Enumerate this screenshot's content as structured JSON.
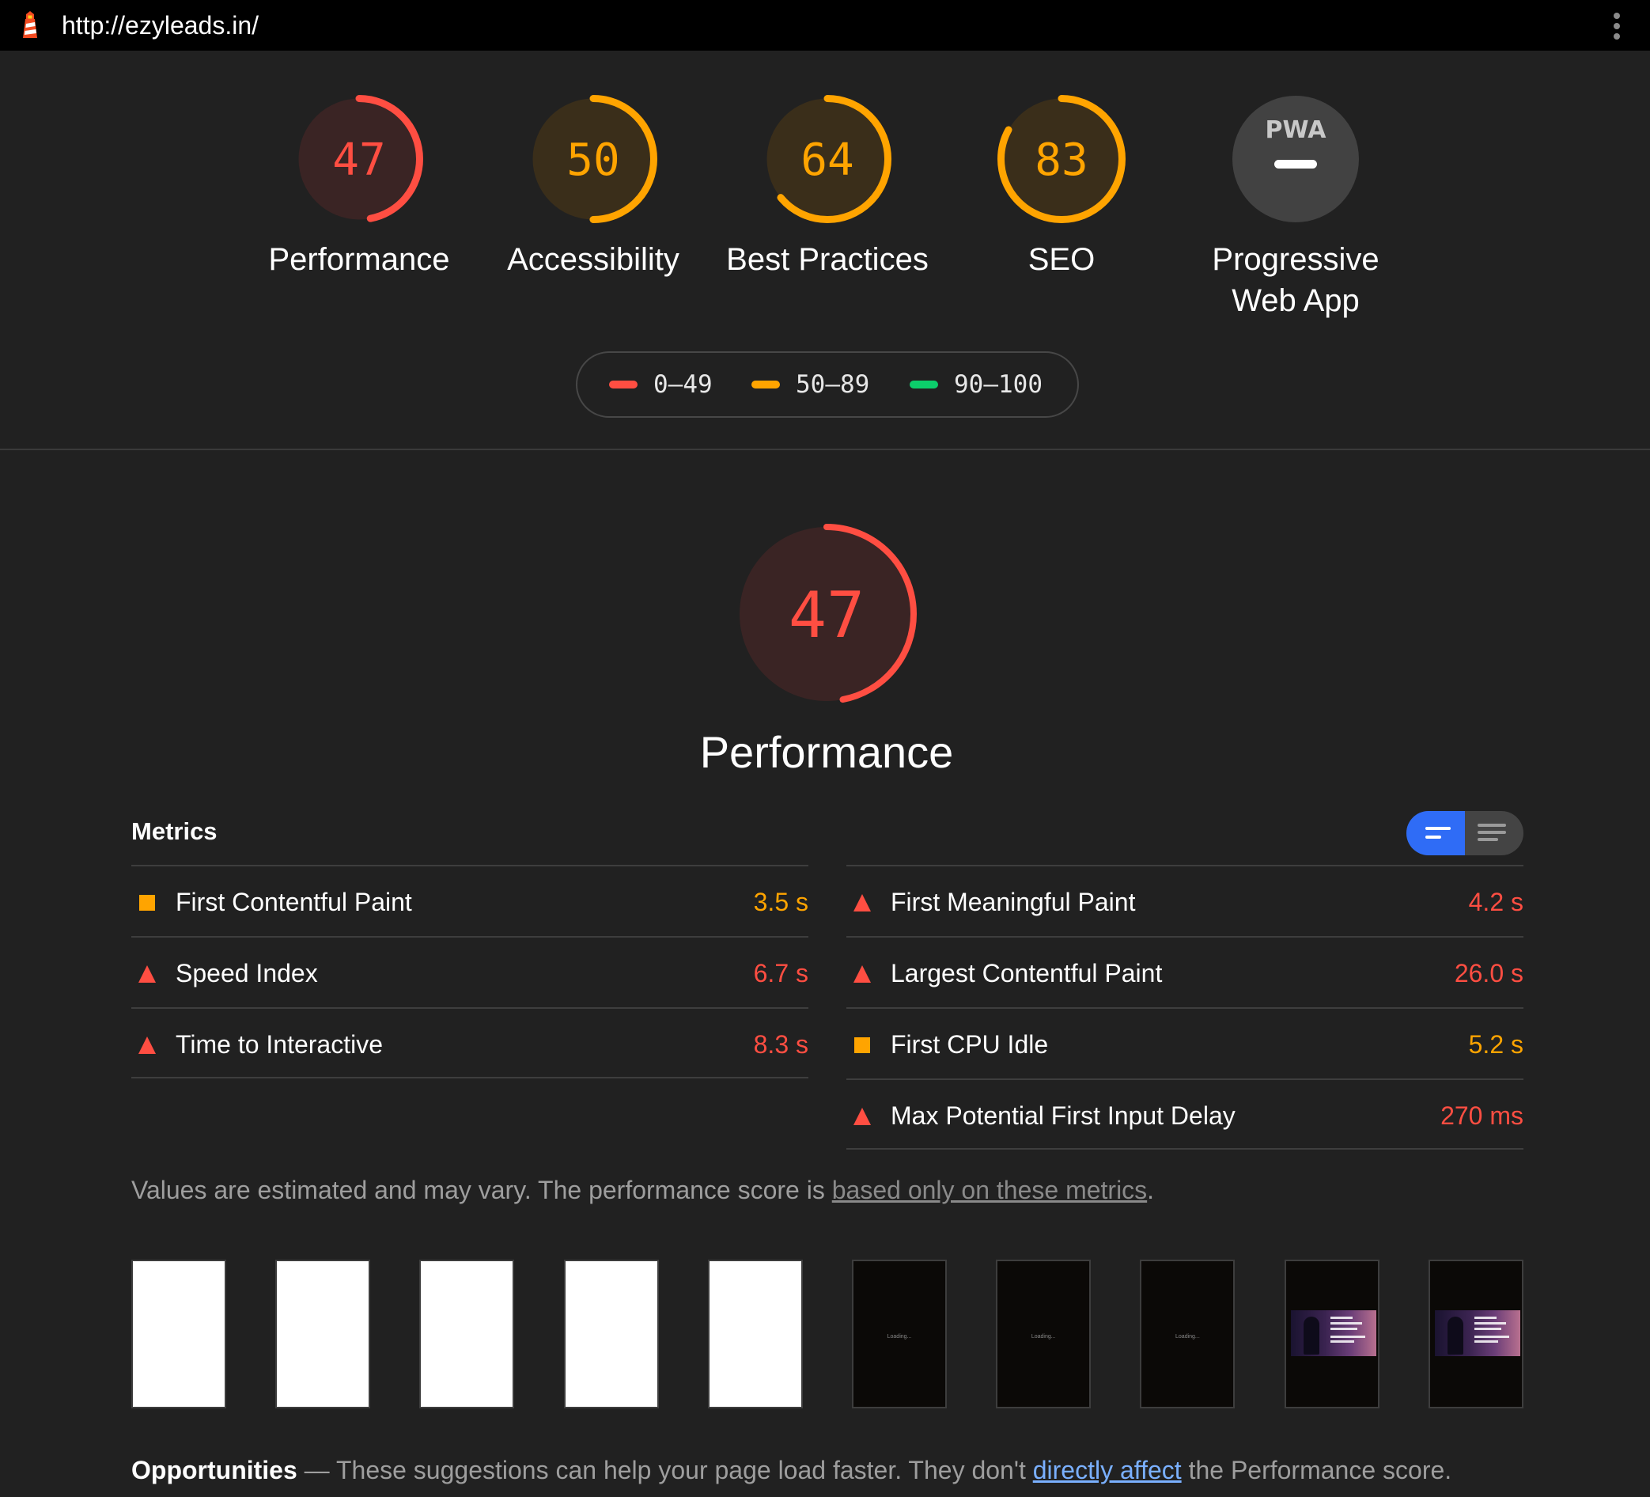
{
  "browser": {
    "url": "http://ezyleads.in/",
    "icon": "lighthouse-icon",
    "menu_icon": "more-vert-icon"
  },
  "colors": {
    "fail": "#ff4e42",
    "average": "#ffa400",
    "pass": "#0cce6b",
    "accent": "#2f6cf6",
    "link": "#7ab0ff"
  },
  "categories": [
    {
      "label": "Performance",
      "score": 47
    },
    {
      "label": "Accessibility",
      "score": 50
    },
    {
      "label": "Best Practices",
      "score": 64
    },
    {
      "label": "SEO",
      "score": 83
    },
    {
      "label": "Progressive Web App",
      "score": null,
      "badge": "PWA"
    }
  ],
  "legend": [
    {
      "range": "0–49"
    },
    {
      "range": "50–89"
    },
    {
      "range": "90–100"
    }
  ],
  "performance": {
    "score": 47,
    "title": "Performance"
  },
  "metrics": {
    "heading": "Metrics",
    "left": [
      {
        "name": "First Contentful Paint",
        "value": "3.5 s",
        "status": "average"
      },
      {
        "name": "Speed Index",
        "value": "6.7 s",
        "status": "fail"
      },
      {
        "name": "Time to Interactive",
        "value": "8.3 s",
        "status": "fail"
      }
    ],
    "right": [
      {
        "name": "First Meaningful Paint",
        "value": "4.2 s",
        "status": "fail"
      },
      {
        "name": "Largest Contentful Paint",
        "value": "26.0 s",
        "status": "fail"
      },
      {
        "name": "First CPU Idle",
        "value": "5.2 s",
        "status": "average"
      },
      {
        "name": "Max Potential First Input Delay",
        "value": "270 ms",
        "status": "fail"
      }
    ]
  },
  "note": {
    "prefix": "Values are estimated and may vary. The performance score is ",
    "link": "based only on these metrics",
    "suffix": "."
  },
  "filmstrip": {
    "frames": [
      "blank",
      "blank",
      "blank",
      "blank",
      "blank",
      "loading",
      "loading",
      "loading",
      "hero",
      "hero"
    ],
    "loading_text": "Loading..."
  },
  "opportunities": {
    "title": "Opportunities",
    "dash": " — ",
    "text": "These suggestions can help your page load faster. They don't ",
    "link": "directly affect",
    "suffix": " the Performance score."
  }
}
